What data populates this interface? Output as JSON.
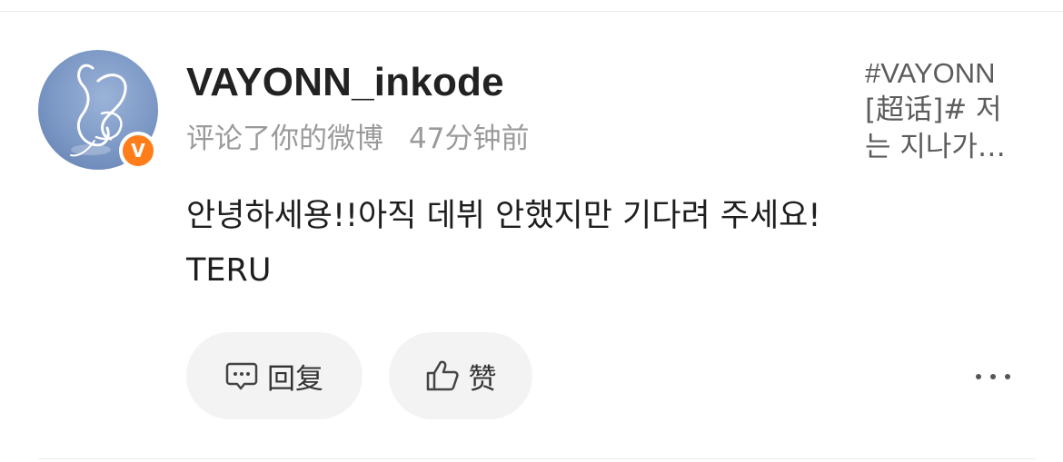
{
  "comment_card": {
    "user": {
      "name": "VAYONN_inkode",
      "badge_letter": "V",
      "badge_color": "#ff7d1a"
    },
    "meta": {
      "action": "评论了你的微博",
      "time": "47分钟前"
    },
    "comment_text": "안녕하세용!!아직 데뷔 안했지만 기다려 주세요! TERU",
    "actions": {
      "reply_label": "回复",
      "like_label": "赞",
      "more_icon": "ellipsis-icon"
    },
    "source_post": {
      "line1": "#VAYONN",
      "line2": "[超话]# 저",
      "line3": "는 지나가…"
    }
  }
}
